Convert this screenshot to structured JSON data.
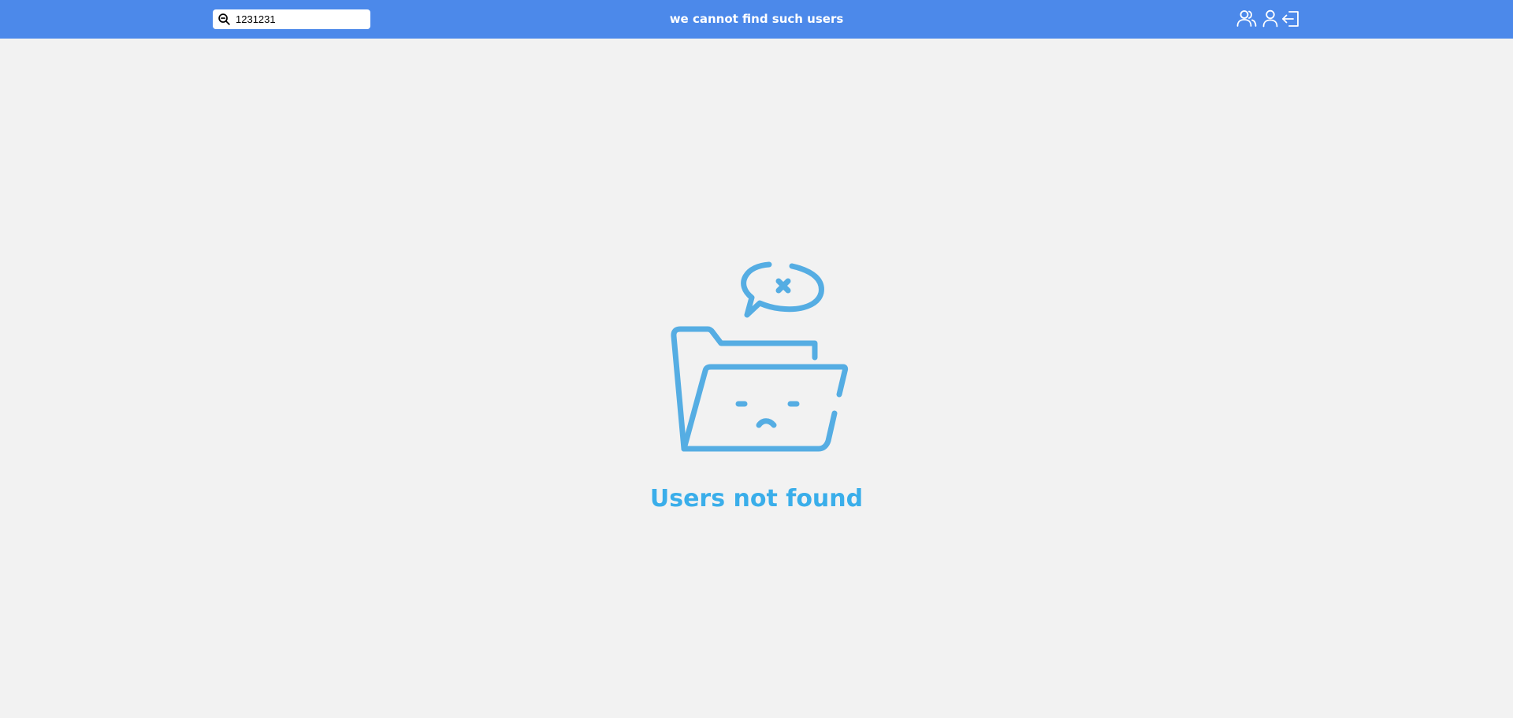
{
  "header": {
    "message": "we cannot find such users",
    "search": {
      "value": "1231231",
      "icon": "search-icon"
    },
    "nav_icons": [
      "users-icon",
      "user-profile-icon",
      "logout-icon"
    ]
  },
  "main": {
    "empty_state": {
      "illustration": "sad-folder-icon",
      "title": "Users not found"
    }
  },
  "colors": {
    "header_bg": "#4c89ea",
    "page_bg": "#f2f2f2",
    "accent": "#3aaeea",
    "illustration": "#55ade3"
  }
}
